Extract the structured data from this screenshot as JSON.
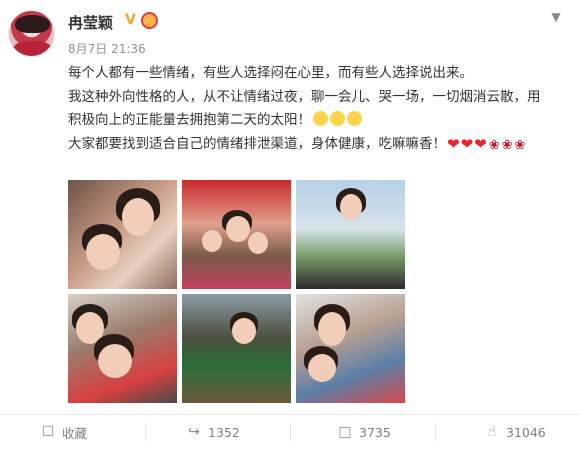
{
  "post": {
    "author": "冉莹颖",
    "timestamp": "8月7日 21:36",
    "text_lines": [
      "每个人都有一些情绪，有些人选择闷在心里，而有些人选择说出来。",
      "我这种外向性格的人，从不让情绪过夜，聊一会儿、哭一场，一切烟消云散，用",
      "积极向上的正能量去拥抱第二天的太阳！",
      "大家都要找到适合自己的情绪排泄渠道，身体健康，吃嘛嘛香！"
    ],
    "photos": [
      {
        "name": "photo-1"
      },
      {
        "name": "photo-2"
      },
      {
        "name": "photo-3"
      },
      {
        "name": "photo-4"
      },
      {
        "name": "photo-5"
      },
      {
        "name": "photo-6"
      }
    ]
  },
  "actions": {
    "favorite": {
      "label": "收藏",
      "icon": "favorite-icon"
    },
    "repost": {
      "count": "1352",
      "icon": "repost-icon"
    },
    "comment": {
      "count": "3735",
      "icon": "comment-icon"
    },
    "like": {
      "count": "31046",
      "icon": "like-icon"
    }
  },
  "colors": {
    "heart": "#e8262a",
    "rose": "#c8102e",
    "vip": "#f5a623"
  }
}
